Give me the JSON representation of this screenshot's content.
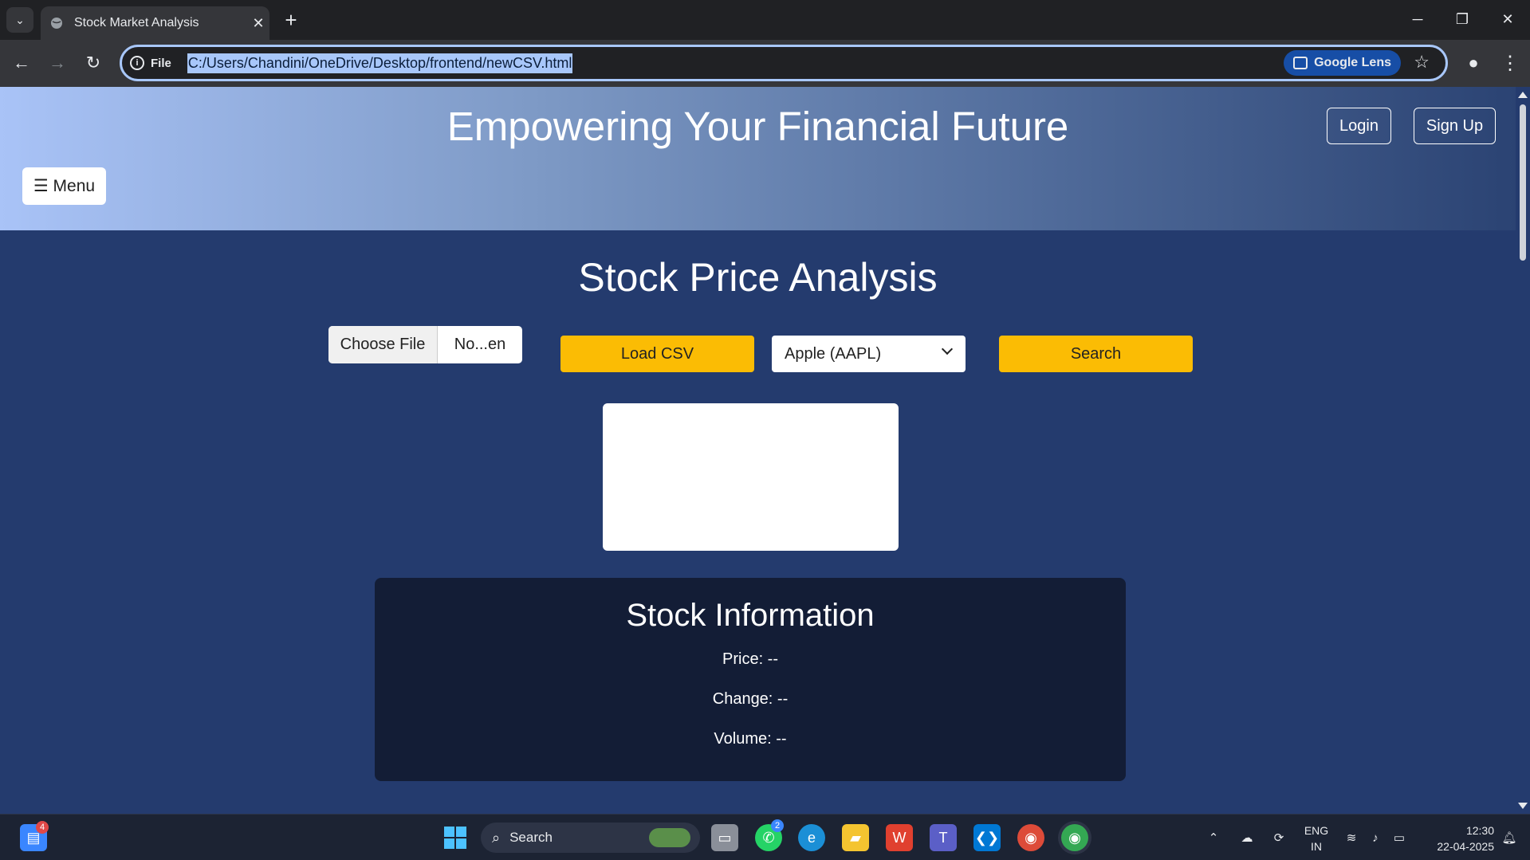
{
  "browser": {
    "tab_title": "Stock Market Analysis",
    "site_label": "File",
    "url": "C:/Users/Chandini/OneDrive/Desktop/frontend/newCSV.html",
    "lens_label": "Google Lens"
  },
  "header": {
    "title": "Empowering Your Financial Future",
    "login_label": "Login",
    "signup_label": "Sign Up",
    "menu_label": "☰ Menu"
  },
  "main": {
    "title": "Stock Price Analysis",
    "choose_file_label": "Choose File",
    "file_name": "No...en",
    "load_csv_label": "Load CSV",
    "selected_stock": "Apple (AAPL)",
    "search_label": "Search"
  },
  "stock_info": {
    "title": "Stock Information",
    "price": "Price: --",
    "change": "Change: --",
    "volume": "Volume: --"
  },
  "taskbar": {
    "search_label": "Search",
    "store_badge": "4",
    "whatsapp_badge": "2",
    "lang_top": "ENG",
    "lang_bottom": "IN",
    "time": "12:30",
    "date": "22-04-2025"
  },
  "colors": {
    "accent_yellow": "#fbbc04",
    "page_bg": "#243b6e",
    "panel_bg": "#131d36"
  }
}
